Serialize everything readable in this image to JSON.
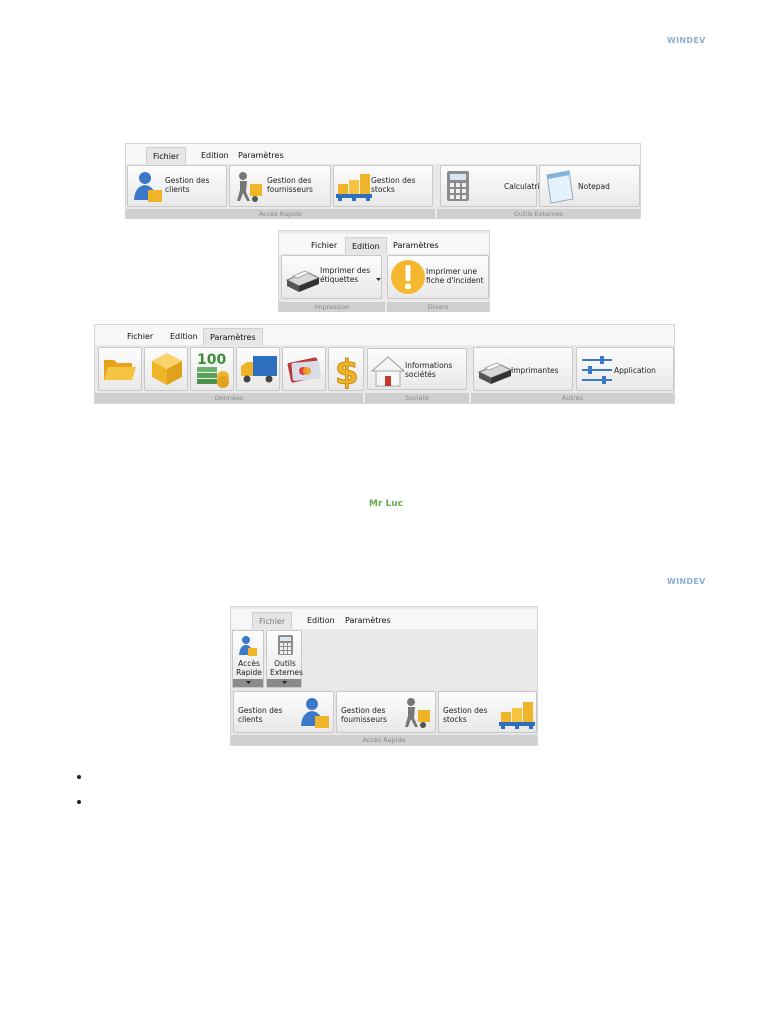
{
  "brand": {
    "name": "WINDEV"
  },
  "author": "Mr Luc",
  "ribbon1": {
    "tabs": [
      "Fichier",
      "Edition",
      "Paramètres"
    ],
    "buttons": [
      {
        "label": "Gestion des\nclients",
        "icon": "user-box-icon"
      },
      {
        "label": "Gestion des\nfournisseurs",
        "icon": "delivery-man-icon"
      },
      {
        "label": "Gestion des\nstocks",
        "icon": "pallet-boxes-icon"
      },
      {
        "label": "Calculatrice",
        "icon": "calculator-icon"
      },
      {
        "label": "Notepad",
        "icon": "notepad-icon"
      }
    ],
    "groups": [
      "Accès Rapide",
      "Outils Externes"
    ]
  },
  "ribbon2": {
    "tabs": [
      "Fichier",
      "Edition",
      "Paramètres"
    ],
    "buttons": [
      {
        "label": "Imprimer des\nétiquettes",
        "icon": "printer-icon"
      },
      {
        "label": "Imprimer une\nfiche d'incident",
        "icon": "warning-icon"
      }
    ],
    "groups": [
      "Impression",
      "Divers"
    ]
  },
  "ribbon3": {
    "tabs": [
      "Fichier",
      "Edition",
      "Paramètres"
    ],
    "buttons": [
      {
        "label": "Informations\nsociétés",
        "icon": "house-icon"
      },
      {
        "label": "Imprimantes",
        "icon": "printer-icon"
      },
      {
        "label": "Application",
        "icon": "sliders-icon"
      }
    ],
    "icon_buttons": [
      "folder-icon",
      "cube-icon",
      "money-icon",
      "truck-icon",
      "credit-card-icon",
      "dollar-icon"
    ],
    "groups": [
      "Données",
      "Société",
      "Autres"
    ]
  },
  "ribbon4": {
    "tabs": [
      "Fichier",
      "Edition",
      "Paramètres"
    ],
    "collapsed": [
      {
        "label": "Accès\nRapide",
        "icon": "user-box-icon"
      },
      {
        "label": "Outils\nExternes",
        "icon": "calculator-icon"
      }
    ],
    "buttons": [
      {
        "label": "Gestion des\nclients",
        "icon": "user-box-icon"
      },
      {
        "label": "Gestion des\nfournisseurs",
        "icon": "delivery-man-icon"
      },
      {
        "label": "Gestion des\nstocks",
        "icon": "pallet-boxes-icon"
      }
    ],
    "groups": [
      "Accès Rapide"
    ]
  },
  "colors": {
    "accent": "#f0b429",
    "brand": "#8ab0d8",
    "author": "#6aa84f"
  }
}
